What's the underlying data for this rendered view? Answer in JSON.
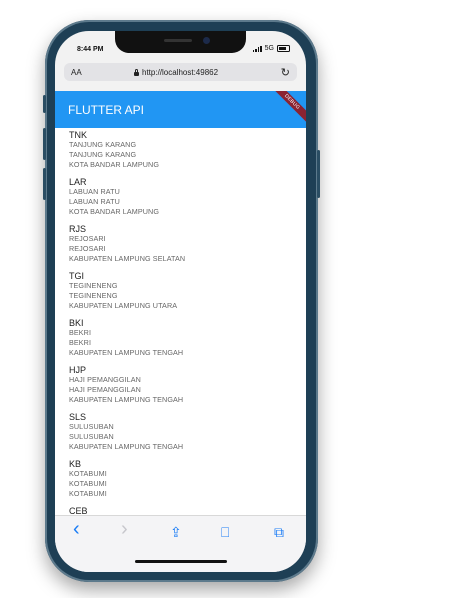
{
  "status_bar": {
    "time": "8:44 PM",
    "network": "5G"
  },
  "browser": {
    "text_size": "AA",
    "url": "http://localhost:49862",
    "reload_icon": "reload-icon",
    "lock_icon": "lock-icon"
  },
  "app_bar": {
    "title": "FLUTTER API",
    "debug_banner": "DEBUG",
    "color": "#2196f3"
  },
  "items": [
    {
      "code": "TNK",
      "line1": "TANJUNG KARANG",
      "line2": "TANJUNG KARANG",
      "line3": "KOTA BANDAR LAMPUNG"
    },
    {
      "code": "LAR",
      "line1": "LABUAN RATU",
      "line2": "LABUAN RATU",
      "line3": "KOTA BANDAR LAMPUNG"
    },
    {
      "code": "RJS",
      "line1": "REJOSARI",
      "line2": "REJOSARI",
      "line3": "KABUPATEN LAMPUNG SELATAN"
    },
    {
      "code": "TGI",
      "line1": "TEGINENENG",
      "line2": "TEGINENENG",
      "line3": "KABUPATEN LAMPUNG UTARA"
    },
    {
      "code": "BKI",
      "line1": "BEKRI",
      "line2": "BEKRI",
      "line3": "KABUPATEN LAMPUNG TENGAH"
    },
    {
      "code": "HJP",
      "line1": "HAJI PEMANGGILAN",
      "line2": "HAJI PEMANGGILAN",
      "line3": "KABUPATEN LAMPUNG TENGAH"
    },
    {
      "code": "SLS",
      "line1": "SULUSUBAN",
      "line2": "SULUSUBAN",
      "line3": "KABUPATEN LAMPUNG TENGAH"
    },
    {
      "code": "KB",
      "line1": "KOTABUMI",
      "line2": "KOTABUMI",
      "line3": "KOTABUMI"
    },
    {
      "code": "CEB",
      "line1": "",
      "line2": "",
      "line3": ""
    }
  ],
  "toolbar": {
    "back": "‹",
    "forward": "›",
    "share": "⇪",
    "bookmarks": "⎕",
    "tabs": "⧉"
  }
}
